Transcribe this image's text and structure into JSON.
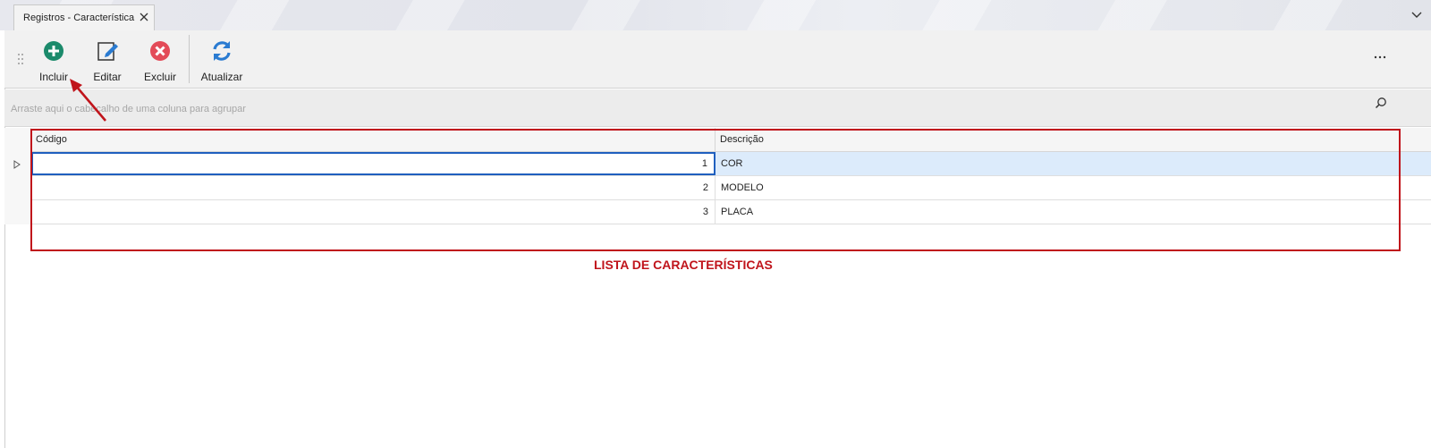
{
  "tab": {
    "title": "Registros - Característica"
  },
  "toolbar": {
    "buttons": [
      {
        "label": "Incluir",
        "icon": "plus-circle-icon",
        "color": "#1b8a6b"
      },
      {
        "label": "Editar",
        "icon": "edit-icon",
        "color": "#2a7bd1"
      },
      {
        "label": "Excluir",
        "icon": "delete-icon",
        "color": "#e34b58"
      },
      {
        "label": "Atualizar",
        "icon": "refresh-icon",
        "color": "#2a7bd1"
      }
    ]
  },
  "grouppanel": {
    "hint": "Arraste aqui o cabeçalho de uma coluna para agrupar"
  },
  "grid": {
    "columns": [
      "Código",
      "Descrição"
    ],
    "rows": [
      {
        "code": "1",
        "desc": "COR"
      },
      {
        "code": "2",
        "desc": "MODELO"
      },
      {
        "code": "3",
        "desc": "PLACA"
      }
    ],
    "selected_row": 0
  },
  "annotation": {
    "text": "LISTA DE CARACTERÍSTICAS",
    "color": "#c0141b"
  }
}
